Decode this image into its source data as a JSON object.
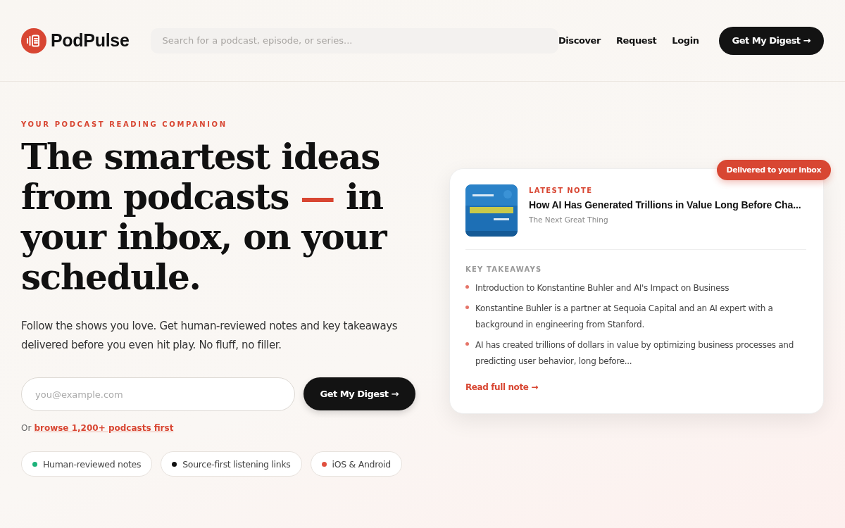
{
  "header": {
    "brand": "PodPulse",
    "search": {
      "placeholder": "Search for a podcast, episode, or series..."
    },
    "nav": [
      "Discover",
      "Request",
      "Login"
    ],
    "cta": "Get My Digest →"
  },
  "hero": {
    "eyebrow": "YOUR PODCAST READING COMPANION",
    "headline": [
      {
        "text": "The smartest ideas from podcasts ",
        "accent": false
      },
      {
        "text": "—",
        "accent": true
      },
      {
        "text": " in your inbox, on your schedule.",
        "accent": false
      }
    ],
    "lead": "Follow the shows you love. Get human-reviewed notes and key takeaways delivered before you even hit play. No fluff, no filler.",
    "email": {
      "placeholder": "you@example.com"
    },
    "submit": "Get My Digest →",
    "browse": {
      "prefix": "Or",
      "link": "browse 1,200+ podcasts first"
    },
    "features": [
      {
        "label": "Human-reviewed notes",
        "color": "#1db27a"
      },
      {
        "label": "Source-first listening links",
        "color": "#111111"
      },
      {
        "label": "iOS & Android",
        "color": "#e0503f"
      }
    ]
  },
  "note_card": {
    "badge": "Delivered to your inbox",
    "eyebrow": "LATEST NOTE",
    "title": "How AI Has Generated Trillions in Value Long Before Cha...",
    "show": "The Next Great Thing",
    "section": "KEY TAKEAWAYS",
    "takeaways": [
      "Introduction to Konstantine Buhler and AI's Impact on Business",
      "Konstantine Buhler is a partner at Sequoia Capital and an AI expert with a background in engineering from Stanford.",
      "AI has created trillions of dollars in value by optimizing business processes and predicting user behavior, long before..."
    ],
    "link": "Read full note →"
  }
}
